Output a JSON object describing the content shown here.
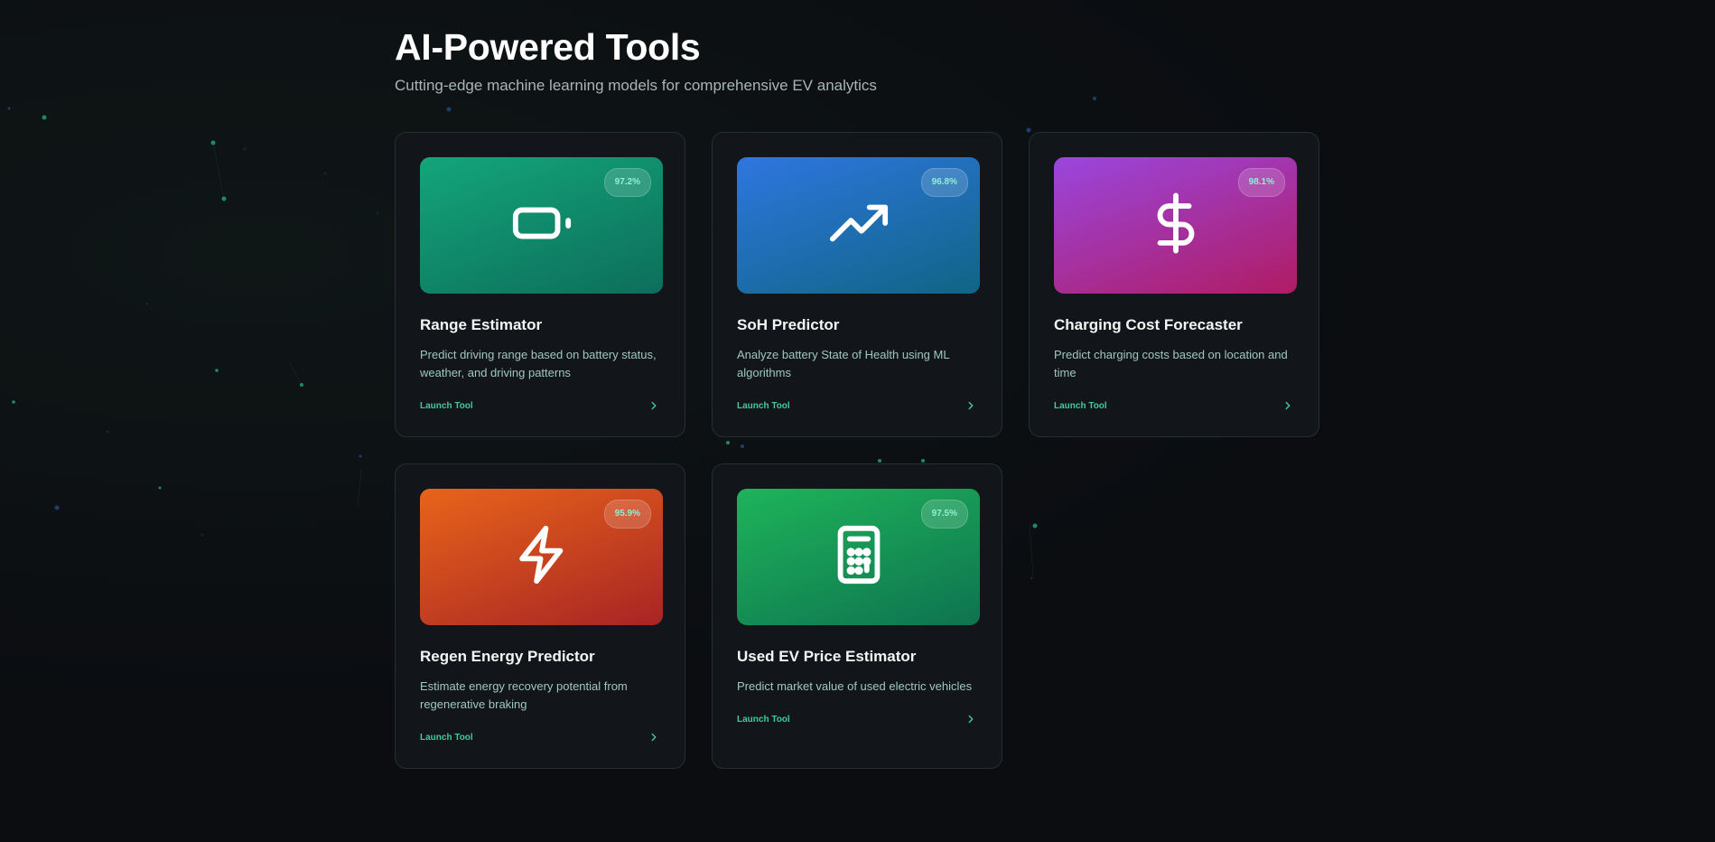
{
  "header": {
    "title": "AI-Powered Tools",
    "subtitle": "Cutting-edge machine learning models for comprehensive EV analytics"
  },
  "tools": [
    {
      "name": "Range Estimator",
      "description": "Predict driving range based on battery status, weather, and driving patterns",
      "accuracy": "97.2%",
      "icon": "battery-icon",
      "gradient": [
        "#13a57a",
        "#0d6e5b"
      ],
      "launch_label": "Launch Tool"
    },
    {
      "name": "SoH Predictor",
      "description": "Analyze battery State of Health using ML algorithms",
      "accuracy": "96.8%",
      "icon": "trending-up-icon",
      "gradient": [
        "#2f76e0",
        "#0f6585"
      ],
      "launch_label": "Launch Tool"
    },
    {
      "name": "Charging Cost Forecaster",
      "description": "Predict charging costs based on location and time",
      "accuracy": "98.1%",
      "icon": "dollar-icon",
      "gradient": [
        "#9a46de",
        "#b01c63"
      ],
      "launch_label": "Launch Tool"
    },
    {
      "name": "Regen Energy Predictor",
      "description": "Estimate energy recovery potential from regenerative braking",
      "accuracy": "95.9%",
      "icon": "lightning-icon",
      "gradient": [
        "#e8641a",
        "#a82424"
      ],
      "launch_label": "Launch Tool"
    },
    {
      "name": "Used EV Price Estimator",
      "description": "Predict market value of used electric vehicles",
      "accuracy": "97.5%",
      "icon": "calculator-icon",
      "gradient": [
        "#1eb45a",
        "#0e7350"
      ],
      "launch_label": "Launch Tool"
    }
  ],
  "colors": {
    "background": "#0b0d11",
    "card_background": "#121519",
    "accent": "#46c99a",
    "badge_text": "#8ff0cf"
  }
}
